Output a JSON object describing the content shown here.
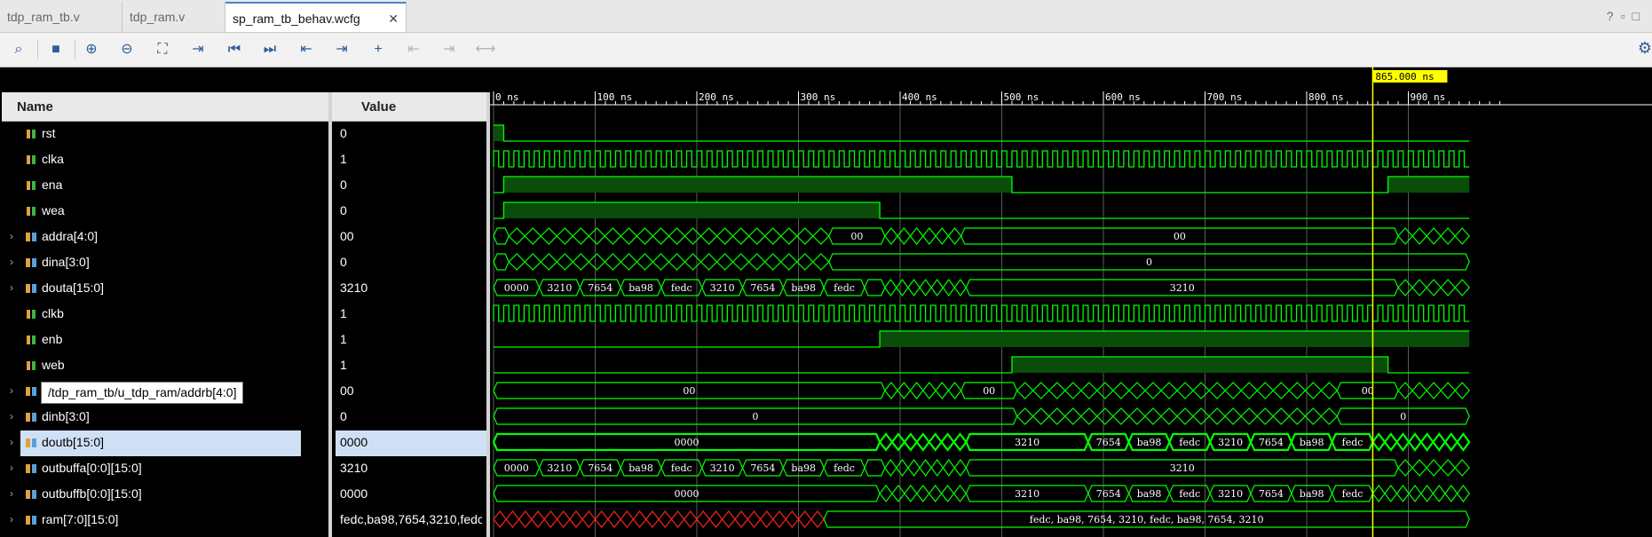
{
  "tabs": [
    {
      "label": "tdp_ram_tb.v",
      "active": false
    },
    {
      "label": "tdp_ram.v",
      "active": false
    },
    {
      "label": "sp_ram_tb_behav.wcfg",
      "active": true
    }
  ],
  "window_buttons": [
    "?",
    "▫",
    "□"
  ],
  "toolbar_icons": [
    "search-icon",
    "save-icon",
    "zoom-in-icon",
    "zoom-out-icon",
    "zoom-fit-icon",
    "go-to-cursor-icon",
    "go-to-time-0-icon",
    "go-to-last-time-icon",
    "previous-transition-icon",
    "next-transition-icon",
    "add-marker-icon",
    "previous-marker-icon",
    "next-marker-icon",
    "swap-cursors-icon",
    "settings-gear-icon"
  ],
  "headers": {
    "name": "Name",
    "value": "Value"
  },
  "signals": [
    {
      "name": "rst",
      "value": "0",
      "expandable": false,
      "bus": false
    },
    {
      "name": "clka",
      "value": "1",
      "expandable": false,
      "bus": false
    },
    {
      "name": "ena",
      "value": "0",
      "expandable": false,
      "bus": false
    },
    {
      "name": "wea",
      "value": "0",
      "expandable": false,
      "bus": false
    },
    {
      "name": "addra[4:0]",
      "value": "00",
      "expandable": true,
      "bus": true
    },
    {
      "name": "dina[3:0]",
      "value": "0",
      "expandable": true,
      "bus": true
    },
    {
      "name": "douta[15:0]",
      "value": "3210",
      "expandable": true,
      "bus": true
    },
    {
      "name": "clkb",
      "value": "1",
      "expandable": false,
      "bus": false
    },
    {
      "name": "enb",
      "value": "1",
      "expandable": false,
      "bus": false
    },
    {
      "name": "web",
      "value": "1",
      "expandable": false,
      "bus": false
    },
    {
      "name": "",
      "value": "00",
      "expandable": true,
      "bus": true
    },
    {
      "name": "dinb[3:0]",
      "value": "0",
      "expandable": true,
      "bus": true
    },
    {
      "name": "doutb[15:0]",
      "value": "0000",
      "expandable": true,
      "bus": true,
      "selected": true
    },
    {
      "name": "outbuffa[0:0][15:0]",
      "value": "3210",
      "expandable": true,
      "bus": true
    },
    {
      "name": "outbuffb[0:0][15:0]",
      "value": "0000",
      "expandable": true,
      "bus": true
    },
    {
      "name": "ram[7:0][15:0]",
      "value": "fedc,ba98,7654,3210,fedc",
      "expandable": true,
      "bus": true
    }
  ],
  "tooltip": "/tdp_ram_tb/u_tdp_ram/addrb[4:0]",
  "cursor": {
    "label": "865.000 ns",
    "time_ns": 865
  },
  "timeline": {
    "ticks": [
      {
        "t": 0,
        "label": "0 ns"
      },
      {
        "t": 100,
        "label": "100 ns"
      },
      {
        "t": 200,
        "label": "200 ns"
      },
      {
        "t": 300,
        "label": "300 ns"
      },
      {
        "t": 400,
        "label": "400 ns"
      },
      {
        "t": 500,
        "label": "500 ns"
      },
      {
        "t": 600,
        "label": "600 ns"
      },
      {
        "t": 700,
        "label": "700 ns"
      },
      {
        "t": 800,
        "label": "800 ns"
      },
      {
        "t": 900,
        "label": "900 ns"
      }
    ],
    "range_ns": [
      0,
      960
    ]
  },
  "waves": [
    {
      "kind": "bit",
      "edges": [
        [
          0,
          1
        ],
        [
          10,
          0
        ]
      ]
    },
    {
      "kind": "clock",
      "period": 10,
      "start": 0,
      "end": 960
    },
    {
      "kind": "bit",
      "edges": [
        [
          0,
          0
        ],
        [
          10,
          1
        ],
        [
          510,
          0
        ],
        [
          880,
          1
        ]
      ]
    },
    {
      "kind": "bit",
      "edges": [
        [
          0,
          0
        ],
        [
          10,
          1
        ],
        [
          380,
          0
        ]
      ]
    },
    {
      "kind": "bus",
      "segs": [
        {
          "s": 0,
          "e": 15,
          "label": "00"
        },
        {
          "s": 15,
          "e": 330,
          "churn": 20
        },
        {
          "s": 330,
          "e": 385,
          "label": "00"
        },
        {
          "s": 385,
          "e": 460,
          "churn": 6
        },
        {
          "s": 460,
          "e": 890,
          "label": "00"
        },
        {
          "s": 890,
          "e": 960,
          "churn": 5
        }
      ]
    },
    {
      "kind": "bus",
      "segs": [
        {
          "s": 0,
          "e": 15,
          "label": "0"
        },
        {
          "s": 15,
          "e": 330,
          "churn": 20
        },
        {
          "s": 330,
          "e": 960,
          "label": "0"
        }
      ]
    },
    {
      "kind": "bus",
      "segs": [
        {
          "s": 0,
          "e": 45,
          "label": "0000"
        },
        {
          "s": 45,
          "e": 85,
          "label": "3210"
        },
        {
          "s": 85,
          "e": 125,
          "label": "7654"
        },
        {
          "s": 125,
          "e": 165,
          "label": "ba98"
        },
        {
          "s": 165,
          "e": 205,
          "label": "fedc"
        },
        {
          "s": 205,
          "e": 245,
          "label": "3210"
        },
        {
          "s": 245,
          "e": 285,
          "label": "7654"
        },
        {
          "s": 285,
          "e": 325,
          "label": "ba98"
        },
        {
          "s": 325,
          "e": 365,
          "label": "fedc"
        },
        {
          "s": 365,
          "e": 385,
          "label": ""
        },
        {
          "s": 385,
          "e": 465,
          "churn": 7
        },
        {
          "s": 465,
          "e": 890,
          "label": "3210"
        },
        {
          "s": 890,
          "e": 960,
          "churn": 5
        }
      ]
    },
    {
      "kind": "clock",
      "period": 10,
      "start": 0,
      "end": 960
    },
    {
      "kind": "bit",
      "edges": [
        [
          0,
          0
        ],
        [
          380,
          1
        ]
      ]
    },
    {
      "kind": "bit",
      "edges": [
        [
          0,
          0
        ],
        [
          510,
          1
        ],
        [
          880,
          0
        ]
      ]
    },
    {
      "kind": "bus",
      "segs": [
        {
          "s": 0,
          "e": 385,
          "label": "00"
        },
        {
          "s": 385,
          "e": 460,
          "churn": 6
        },
        {
          "s": 460,
          "e": 515,
          "label": "00"
        },
        {
          "s": 515,
          "e": 830,
          "churn": 20
        },
        {
          "s": 830,
          "e": 890,
          "label": "00"
        },
        {
          "s": 890,
          "e": 960,
          "churn": 5
        }
      ]
    },
    {
      "kind": "bus",
      "segs": [
        {
          "s": 0,
          "e": 515,
          "label": "0"
        },
        {
          "s": 515,
          "e": 830,
          "churn": 20
        },
        {
          "s": 830,
          "e": 960,
          "label": "0"
        }
      ]
    },
    {
      "kind": "bus",
      "bold": true,
      "segs": [
        {
          "s": 0,
          "e": 380,
          "label": "0000"
        },
        {
          "s": 380,
          "e": 465,
          "churn": 7
        },
        {
          "s": 465,
          "e": 585,
          "label": "3210"
        },
        {
          "s": 585,
          "e": 625,
          "label": "7654"
        },
        {
          "s": 625,
          "e": 665,
          "label": "ba98"
        },
        {
          "s": 665,
          "e": 705,
          "label": "fedc"
        },
        {
          "s": 705,
          "e": 745,
          "label": "3210"
        },
        {
          "s": 745,
          "e": 785,
          "label": "7654"
        },
        {
          "s": 785,
          "e": 825,
          "label": "ba98"
        },
        {
          "s": 825,
          "e": 865,
          "label": "fedc"
        },
        {
          "s": 865,
          "e": 960,
          "churn": 8
        }
      ]
    },
    {
      "kind": "bus",
      "segs": [
        {
          "s": 0,
          "e": 45,
          "label": "0000"
        },
        {
          "s": 45,
          "e": 85,
          "label": "3210"
        },
        {
          "s": 85,
          "e": 125,
          "label": "7654"
        },
        {
          "s": 125,
          "e": 165,
          "label": "ba98"
        },
        {
          "s": 165,
          "e": 205,
          "label": "fedc"
        },
        {
          "s": 205,
          "e": 245,
          "label": "3210"
        },
        {
          "s": 245,
          "e": 285,
          "label": "7654"
        },
        {
          "s": 285,
          "e": 325,
          "label": "ba98"
        },
        {
          "s": 325,
          "e": 365,
          "label": "fedc"
        },
        {
          "s": 365,
          "e": 385,
          "label": ""
        },
        {
          "s": 385,
          "e": 465,
          "churn": 7
        },
        {
          "s": 465,
          "e": 890,
          "label": "3210"
        },
        {
          "s": 890,
          "e": 960,
          "churn": 5
        }
      ]
    },
    {
      "kind": "bus",
      "segs": [
        {
          "s": 0,
          "e": 380,
          "label": "0000"
        },
        {
          "s": 380,
          "e": 465,
          "churn": 7
        },
        {
          "s": 465,
          "e": 585,
          "label": "3210"
        },
        {
          "s": 585,
          "e": 625,
          "label": "7654"
        },
        {
          "s": 625,
          "e": 665,
          "label": "ba98"
        },
        {
          "s": 665,
          "e": 705,
          "label": "fedc"
        },
        {
          "s": 705,
          "e": 745,
          "label": "3210"
        },
        {
          "s": 745,
          "e": 785,
          "label": "7654"
        },
        {
          "s": 785,
          "e": 825,
          "label": "ba98"
        },
        {
          "s": 825,
          "e": 865,
          "label": "fedc"
        },
        {
          "s": 865,
          "e": 960,
          "churn": 8
        }
      ]
    },
    {
      "kind": "bus",
      "segs": [
        {
          "s": 0,
          "e": 325,
          "churn": 26,
          "red": true
        },
        {
          "s": 325,
          "e": 960,
          "label": "fedc, ba98, 7654, 3210, fedc, ba98, 7654, 3210"
        }
      ]
    }
  ],
  "colors": {
    "wave": "#00ff00",
    "bus_fill": "#0a4d0a",
    "undefined": "#ff2020",
    "cursor": "#ffff00",
    "grid": "#5a5a5a",
    "selected": "#cfe0f5"
  }
}
